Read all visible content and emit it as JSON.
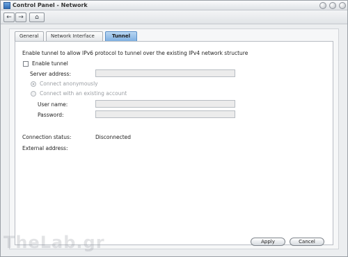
{
  "window": {
    "title": "Control Panel - Network"
  },
  "toolbar": {
    "back_icon": "arrow-left-icon",
    "forward_icon": "arrow-right-icon",
    "home_icon": "home-icon"
  },
  "tabs": [
    {
      "label": "General",
      "active": false
    },
    {
      "label": "Network Interface",
      "active": false
    },
    {
      "label": "Tunnel",
      "active": true
    }
  ],
  "tunnel": {
    "description": "Enable tunnel to allow IPv6 protocol to tunnel over the existing IPv4 network structure",
    "enable_label": "Enable tunnel",
    "enable_checked": false,
    "server_address_label": "Server address:",
    "server_address_value": "",
    "connect_anon_label": "Connect anonymously",
    "connect_anon_selected": true,
    "connect_account_label": "Connect with an existing account",
    "username_label": "User name:",
    "username_value": "",
    "password_label": "Password:",
    "password_value": "",
    "connection_status_label": "Connection status:",
    "connection_status_value": "Disconnected",
    "external_address_label": "External address:",
    "external_address_value": ""
  },
  "buttons": {
    "apply": "Apply",
    "cancel": "Cancel"
  },
  "watermark": "TheLab.gr"
}
